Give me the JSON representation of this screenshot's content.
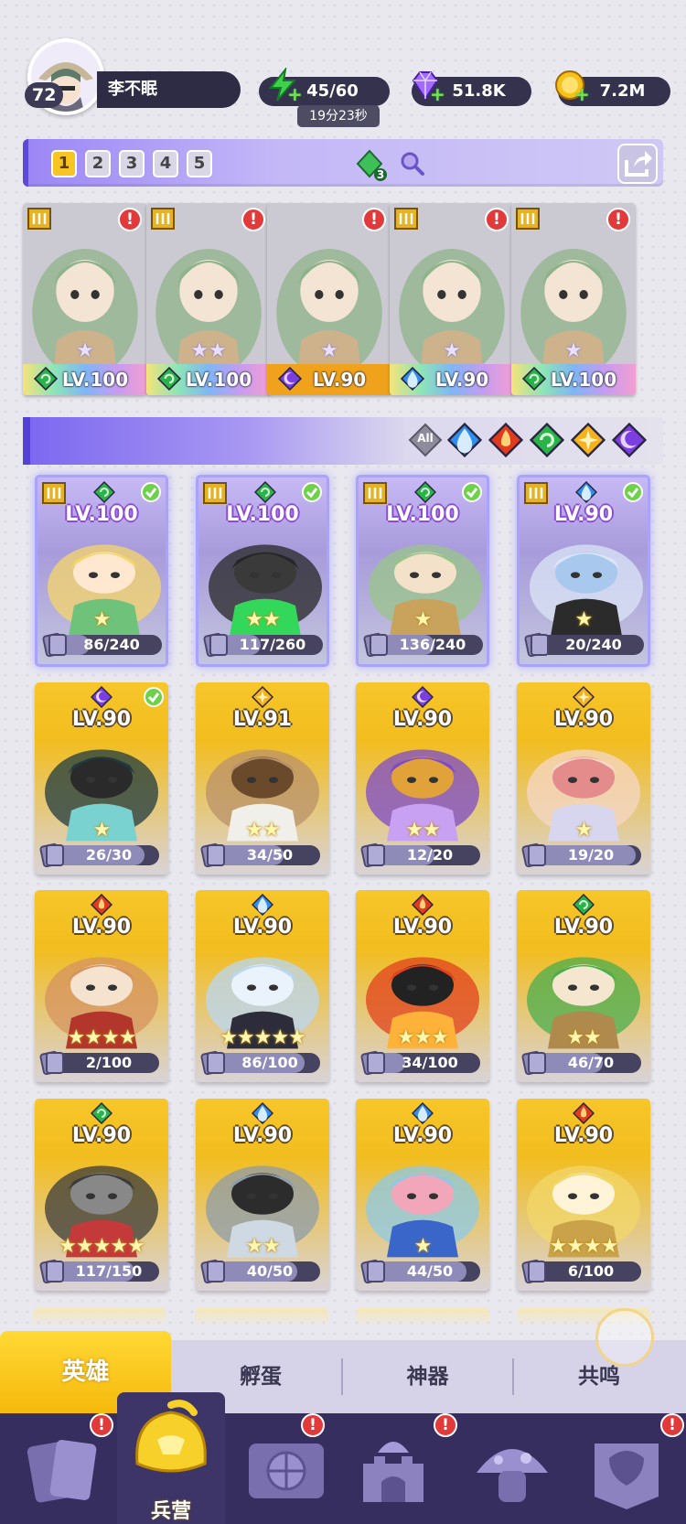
{
  "player": {
    "level": "72",
    "name": "李不眠"
  },
  "resources": {
    "energy": "45/60",
    "energy_timer": "19分23秒",
    "gems": "51.8K",
    "gold": "7.2M"
  },
  "team_tabs": [
    "1",
    "2",
    "3",
    "4",
    "5"
  ],
  "team_gem_count": "3",
  "team": [
    {
      "level": "LV.100",
      "element": "wind",
      "frame": "rainbow",
      "stars": "★",
      "tier": "III"
    },
    {
      "level": "LV.100",
      "element": "wind",
      "frame": "rainbow",
      "stars": "★★",
      "tier": "III"
    },
    {
      "level": "LV.90",
      "element": "dark",
      "frame": "orange",
      "stars": "★",
      "tier": ""
    },
    {
      "level": "LV.90",
      "element": "water",
      "frame": "rainbow",
      "stars": "★",
      "tier": "III"
    },
    {
      "level": "LV.100",
      "element": "wind",
      "frame": "rainbow",
      "stars": "★",
      "tier": "III"
    }
  ],
  "filters": {
    "all_label": "All",
    "elements": [
      "water",
      "fire",
      "wind",
      "light",
      "dark"
    ]
  },
  "heroes": [
    {
      "level": "LV.100",
      "progress": "86/240",
      "fraction": 0.36,
      "element": "wind",
      "stars": "★",
      "frame": "purp",
      "check": true,
      "tier": true,
      "palette": [
        "#f5d66a",
        "#6fc27a",
        "#ffe8cf"
      ]
    },
    {
      "level": "LV.100",
      "progress": "117/260",
      "fraction": 0.45,
      "element": "wind",
      "stars": "★★",
      "frame": "purp",
      "check": true,
      "tier": true,
      "palette": [
        "#262626",
        "#33d85a",
        "#3a3a3a"
      ]
    },
    {
      "level": "LV.100",
      "progress": "136/240",
      "fraction": 0.57,
      "element": "wind",
      "stars": "★",
      "frame": "purp",
      "check": true,
      "tier": true,
      "palette": [
        "#9ac58a",
        "#c9a25c",
        "#f3e2c9"
      ]
    },
    {
      "level": "LV.90",
      "progress": "20/240",
      "fraction": 0.08,
      "element": "water",
      "stars": "★",
      "frame": "purp",
      "check": true,
      "tier": true,
      "palette": [
        "#dbe6f6",
        "#2b2b2b",
        "#a9c8ee"
      ]
    },
    {
      "level": "LV.90",
      "progress": "26/30",
      "fraction": 0.87,
      "element": "dark",
      "stars": "★",
      "frame": "gold",
      "check": true,
      "tier": false,
      "palette": [
        "#1f3b3f",
        "#7ad2d0",
        "#2a2a2a"
      ]
    },
    {
      "level": "LV.91",
      "progress": "34/50",
      "fraction": 0.68,
      "element": "light",
      "stars": "★★",
      "frame": "gold",
      "check": false,
      "tier": false,
      "palette": [
        "#b9916a",
        "#f1efe9",
        "#6b4a2c"
      ]
    },
    {
      "level": "LV.90",
      "progress": "12/20",
      "fraction": 0.6,
      "element": "dark",
      "stars": "★★",
      "frame": "gold",
      "check": false,
      "tier": false,
      "palette": [
        "#7d4bc8",
        "#c9a1f2",
        "#e1a23a"
      ]
    },
    {
      "level": "LV.90",
      "progress": "19/20",
      "fraction": 0.95,
      "element": "light",
      "stars": "★",
      "frame": "gold",
      "check": false,
      "tier": false,
      "palette": [
        "#f6d7c7",
        "#d7d6ee",
        "#e48b8b"
      ]
    },
    {
      "level": "LV.90",
      "progress": "2/100",
      "fraction": 0.02,
      "element": "fire",
      "stars": "★★★★",
      "frame": "gold",
      "check": false,
      "tier": false,
      "palette": [
        "#d59360",
        "#b2362b",
        "#f6e3cf"
      ]
    },
    {
      "level": "LV.90",
      "progress": "86/100",
      "fraction": 0.86,
      "element": "water",
      "stars": "★★★★★",
      "frame": "gold",
      "check": false,
      "tier": false,
      "palette": [
        "#b9d7f3",
        "#2c2c3a",
        "#eaf2fb"
      ]
    },
    {
      "level": "LV.90",
      "progress": "34/100",
      "fraction": 0.34,
      "element": "fire",
      "stars": "★★★",
      "frame": "gold",
      "check": false,
      "tier": false,
      "palette": [
        "#e2421c",
        "#ffb23a",
        "#222222"
      ]
    },
    {
      "level": "LV.90",
      "progress": "46/70",
      "fraction": 0.66,
      "element": "wind",
      "stars": "★★",
      "frame": "gold",
      "check": false,
      "tier": false,
      "palette": [
        "#4bae4f",
        "#b08a4c",
        "#f4e6cf"
      ]
    },
    {
      "level": "LV.90",
      "progress": "117/150",
      "fraction": 0.78,
      "element": "wind",
      "stars": "★★★★★",
      "frame": "gold",
      "check": false,
      "tier": false,
      "palette": [
        "#3b3b3b",
        "#c43a3a",
        "#888888"
      ]
    },
    {
      "level": "LV.90",
      "progress": "40/50",
      "fraction": 0.8,
      "element": "water",
      "stars": "★★",
      "frame": "gold",
      "check": false,
      "tier": false,
      "palette": [
        "#8e9caa",
        "#cfd9e3",
        "#2c2c2c"
      ]
    },
    {
      "level": "LV.90",
      "progress": "44/50",
      "fraction": 0.88,
      "element": "water",
      "stars": "★",
      "frame": "gold",
      "check": false,
      "tier": false,
      "palette": [
        "#8cc9e8",
        "#3a66c9",
        "#f2a6b9"
      ]
    },
    {
      "level": "LV.90",
      "progress": "6/100",
      "fraction": 0.06,
      "element": "fire",
      "stars": "★★★★",
      "frame": "gold",
      "check": false,
      "tier": false,
      "palette": [
        "#f1d76a",
        "#c9a24a",
        "#fff3d8"
      ]
    }
  ],
  "subtabs": {
    "heroes": "英雄",
    "hatch": "孵蛋",
    "artifact": "神器",
    "resonance": "共鸣"
  },
  "nav": {
    "active_label": "兵营"
  },
  "colors": {
    "water": "#2f8ef0",
    "fire": "#e23a1c",
    "wind": "#2bb34b",
    "light": "#f5b21a",
    "dark": "#7b3ee0",
    "accent": "#f7c521",
    "nav": "#352e5e"
  }
}
